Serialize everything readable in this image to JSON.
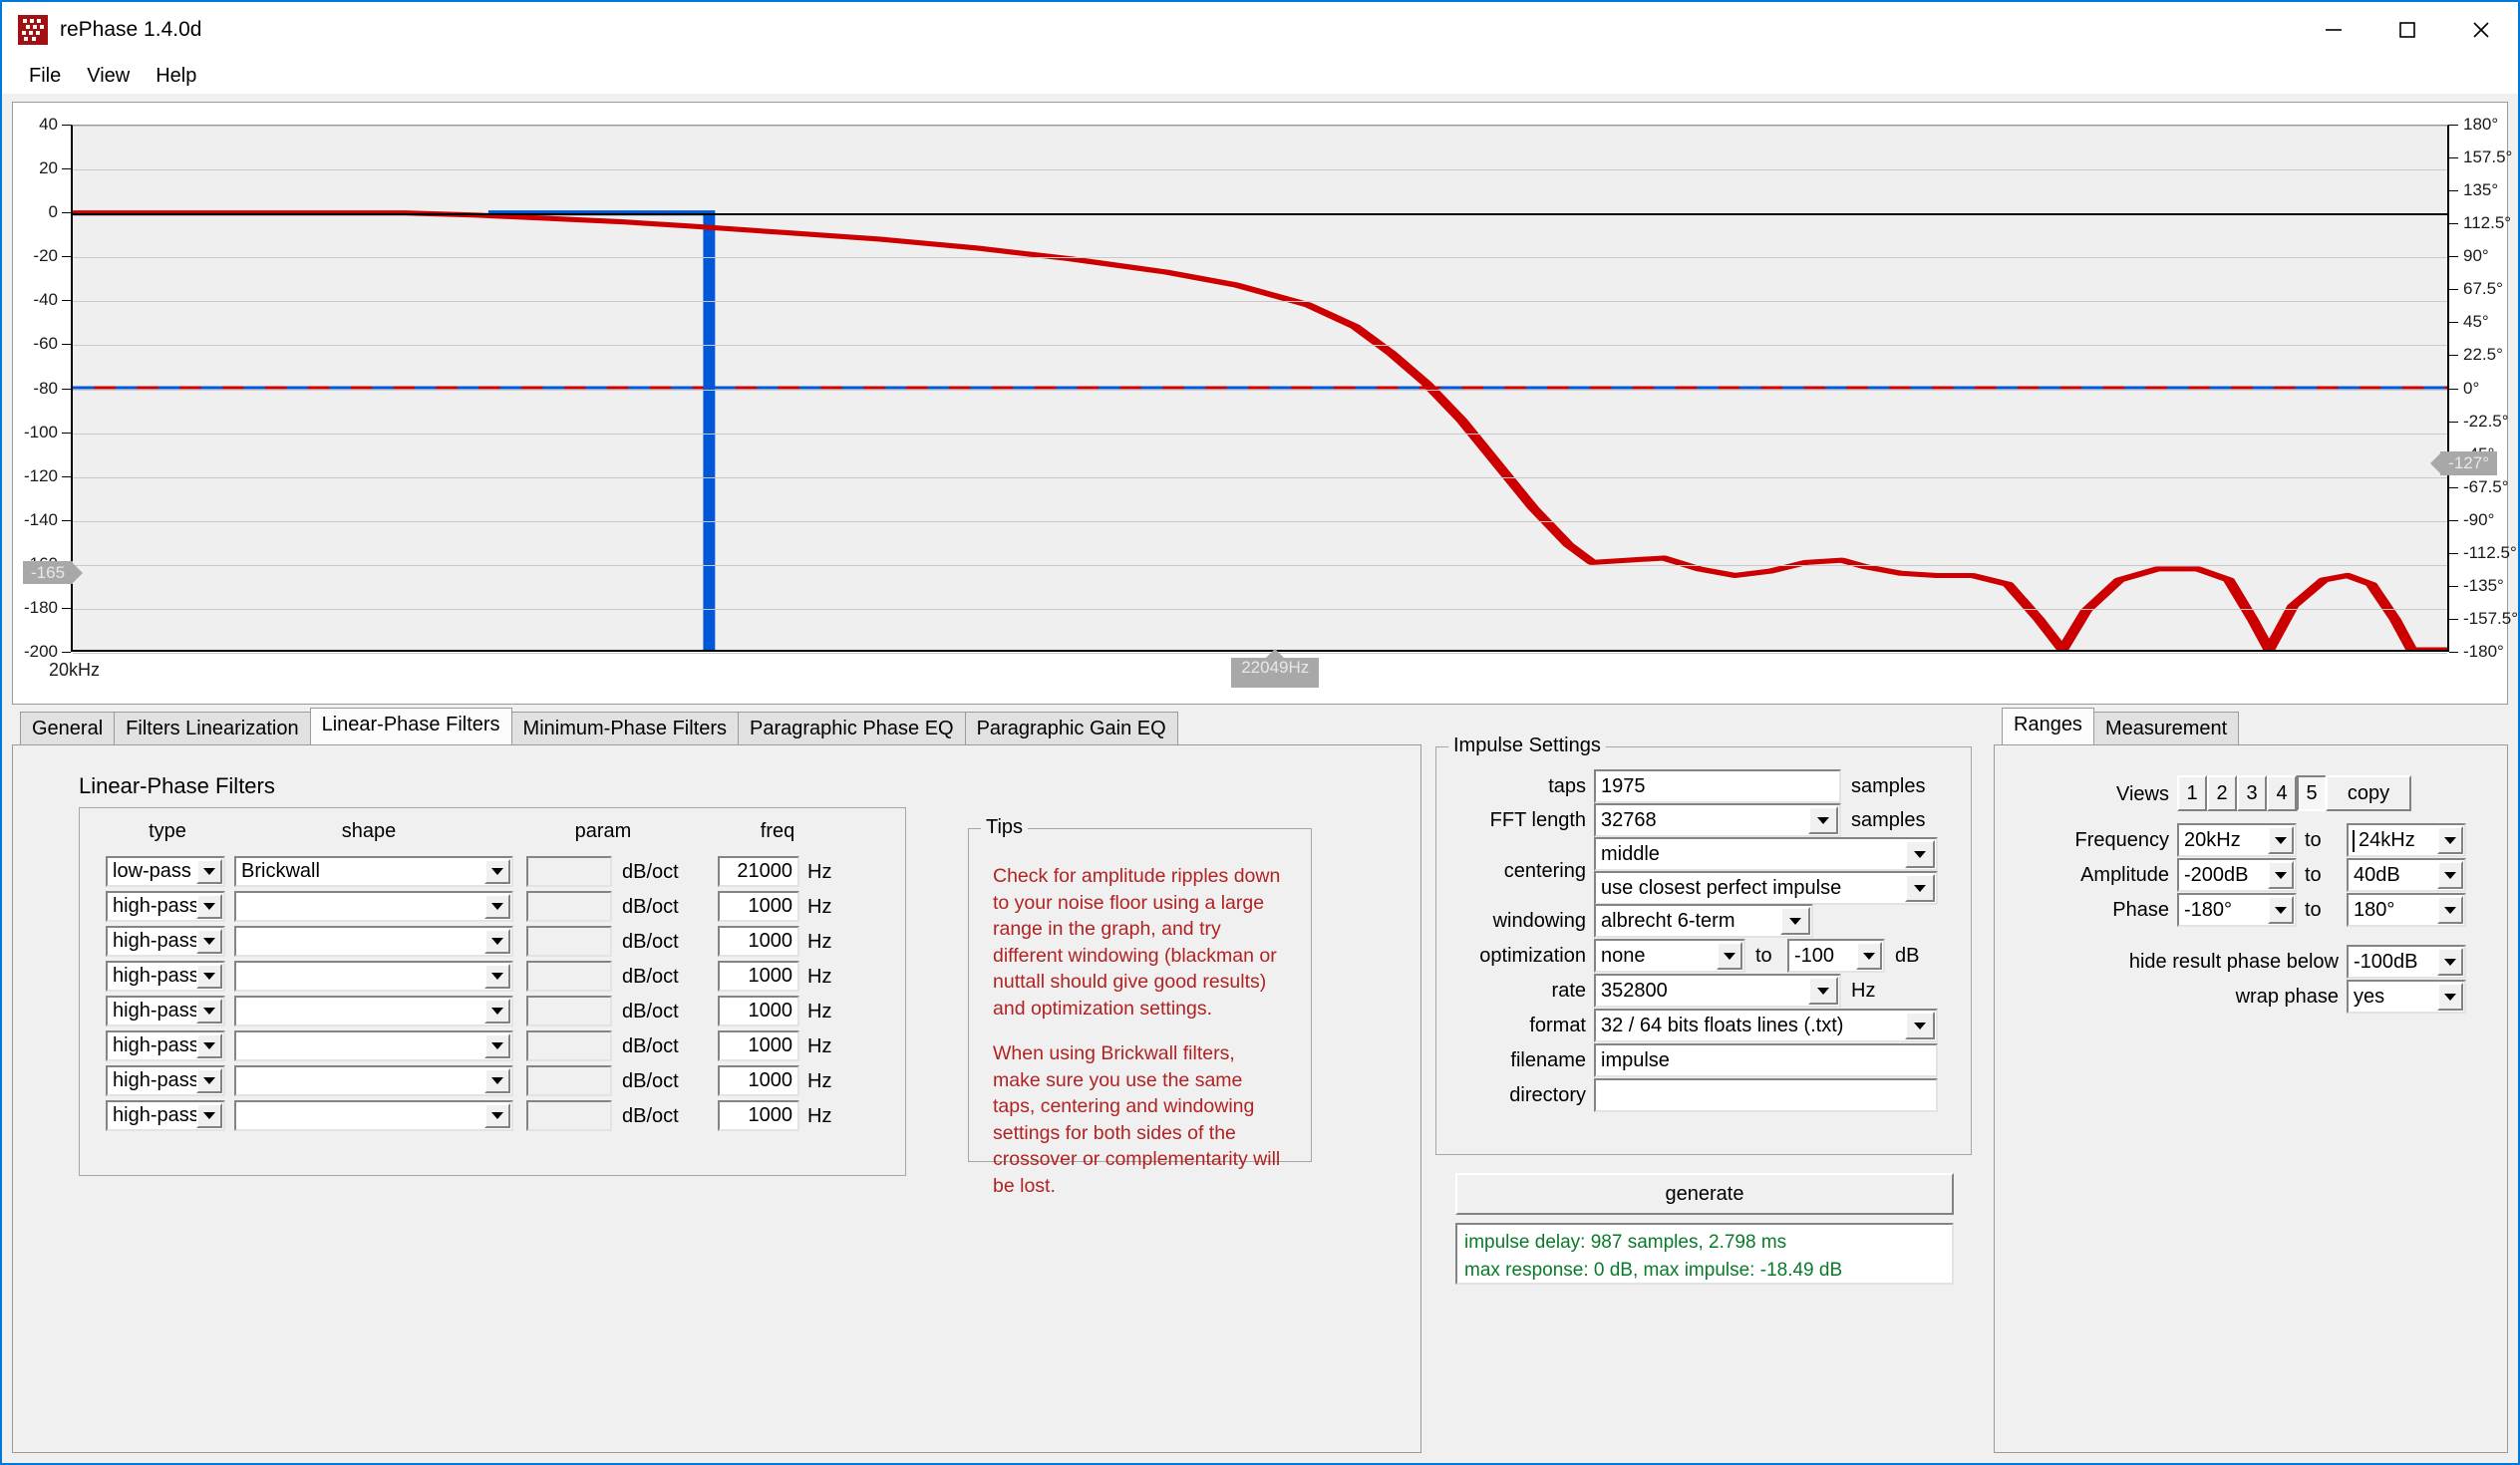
{
  "window": {
    "title": "rePhase 1.4.0d",
    "icon": "rephase-logo-icon",
    "minimize": "─",
    "maximize": "□",
    "close": "✕"
  },
  "menu": {
    "items": [
      "File",
      "View",
      "Help"
    ]
  },
  "chart_data": {
    "type": "line",
    "title": "",
    "xlabel": "",
    "ylabel": "",
    "x_axis_label_left": "20kHz",
    "xlim_labels": [
      "20kHz",
      "24kHz"
    ],
    "y_left_ticks": [
      40,
      20,
      0,
      -20,
      -40,
      -60,
      -80,
      -100,
      -120,
      -140,
      -160,
      -180,
      -200
    ],
    "y_left_unit": "dB",
    "ylim": [
      -200,
      40
    ],
    "y_right_ticks": [
      "180°",
      "157.5°",
      "135°",
      "112.5°",
      "90°",
      "67.5°",
      "45°",
      "22.5°",
      "0°",
      "-22.5°",
      "-45°",
      "-67.5°",
      "-90°",
      "-112.5°",
      "-135°",
      "-157.5°",
      "-180°"
    ],
    "y_right_unit": "degrees",
    "grid": true,
    "legend": "none",
    "cursor_markers": {
      "amplitude": "-165",
      "phase": "-127°",
      "frequency": "22049Hz"
    },
    "series": [
      {
        "name": "amplitude",
        "color": "#cc0000",
        "style": "solid",
        "description": "Brickwall low-pass 21000 Hz magnitude response: flat at 0 dB to ~20.7kHz, gentle roll-off, steep descent past 21kHz to ~-160 dB stopband with scalloped ripple lobes",
        "points": [
          [
            0.0,
            0.0
          ],
          [
            0.14,
            0.0
          ],
          [
            0.17,
            -1.0
          ],
          [
            0.2,
            -2.5
          ],
          [
            0.23,
            -4.0
          ],
          [
            0.26,
            -6.0
          ],
          [
            0.3,
            -9.0
          ],
          [
            0.34,
            -12.0
          ],
          [
            0.38,
            -16.0
          ],
          [
            0.42,
            -21.0
          ],
          [
            0.46,
            -27.0
          ],
          [
            0.49,
            -33.0
          ],
          [
            0.52,
            -42.0
          ],
          [
            0.54,
            -52.0
          ],
          [
            0.555,
            -64.0
          ],
          [
            0.57,
            -78.0
          ],
          [
            0.585,
            -95.0
          ],
          [
            0.6,
            -115.0
          ],
          [
            0.615,
            -135.0
          ],
          [
            0.63,
            -152.0
          ],
          [
            0.64,
            -160.0
          ],
          [
            0.655,
            -159.0
          ],
          [
            0.67,
            -158.0
          ],
          [
            0.685,
            -163.0
          ],
          [
            0.7,
            -166.0
          ],
          [
            0.715,
            -164.0
          ],
          [
            0.73,
            -160.0
          ],
          [
            0.745,
            -159.0
          ],
          [
            0.755,
            -162.0
          ],
          [
            0.77,
            -165.0
          ],
          [
            0.785,
            -166.0
          ],
          [
            0.8,
            -166.0
          ],
          [
            0.815,
            -170.0
          ],
          [
            0.828,
            -186.0
          ],
          [
            0.838,
            -200.0
          ],
          [
            0.848,
            -182.0
          ],
          [
            0.862,
            -168.0
          ],
          [
            0.878,
            -163.0
          ],
          [
            0.895,
            -163.0
          ],
          [
            0.908,
            -168.0
          ],
          [
            0.918,
            -186.0
          ],
          [
            0.925,
            -200.0
          ],
          [
            0.935,
            -180.0
          ],
          [
            0.948,
            -168.0
          ],
          [
            0.958,
            -166.0
          ],
          [
            0.968,
            -170.0
          ],
          [
            0.978,
            -186.0
          ],
          [
            0.985,
            -200.0
          ],
          [
            1.0,
            -200.0
          ]
        ]
      },
      {
        "name": "phase",
        "color": "#0057d8",
        "style": "solid",
        "description": "Linear phase trace: flat at 0 dB reference from ~20.6kHz, then vertical drop at the 21kHz cutoff"
      },
      {
        "name": "hide-phase-threshold",
        "color": "#0057d8",
        "style": "dashed",
        "value_db": -80,
        "description": "dashed blue/red horizontal line at -80 dB"
      },
      {
        "name": "zero-reference",
        "color": "#000000",
        "style": "solid",
        "value_db": 0
      }
    ]
  },
  "main_tabs": {
    "items": [
      "General",
      "Filters Linearization",
      "Linear-Phase Filters",
      "Minimum-Phase Filters",
      "Paragraphic Phase EQ",
      "Paragraphic Gain EQ"
    ],
    "active_index": 2
  },
  "linear_phase_filters": {
    "section_title": "Linear-Phase Filters",
    "columns": [
      "type",
      "shape",
      "param",
      "freq"
    ],
    "param_unit": "dB/oct",
    "freq_unit": "Hz",
    "rows": [
      {
        "type": "low-pass",
        "shape": "Brickwall",
        "param": "",
        "freq": "21000"
      },
      {
        "type": "high-pass",
        "shape": "",
        "param": "",
        "freq": "1000"
      },
      {
        "type": "high-pass",
        "shape": "",
        "param": "",
        "freq": "1000"
      },
      {
        "type": "high-pass",
        "shape": "",
        "param": "",
        "freq": "1000"
      },
      {
        "type": "high-pass",
        "shape": "",
        "param": "",
        "freq": "1000"
      },
      {
        "type": "high-pass",
        "shape": "",
        "param": "",
        "freq": "1000"
      },
      {
        "type": "high-pass",
        "shape": "",
        "param": "",
        "freq": "1000"
      },
      {
        "type": "high-pass",
        "shape": "",
        "param": "",
        "freq": "1000"
      }
    ]
  },
  "tips": {
    "title": "Tips",
    "paragraph1": "Check for amplitude ripples down to your noise floor using a large range in the graph, and try different windowing (blackman or nuttall should give good results) and optimization settings.",
    "paragraph2": "When using Brickwall filters, make sure you use the same taps, centering and windowing settings for both sides of the crossover or complementarity will be lost."
  },
  "impulse_settings": {
    "title": "Impulse Settings",
    "taps": {
      "label": "taps",
      "value": "1975",
      "unit": "samples"
    },
    "fft_length": {
      "label": "FFT length",
      "value": "32768",
      "unit": "samples"
    },
    "centering": {
      "label": "centering",
      "value1": "middle",
      "value2": "use closest perfect impulse"
    },
    "windowing": {
      "label": "windowing",
      "value": "albrecht 6-term"
    },
    "optimization": {
      "label": "optimization",
      "value": "none",
      "to_label": "to",
      "to_value": "-100",
      "unit": "dB"
    },
    "rate": {
      "label": "rate",
      "value": "352800",
      "unit": "Hz"
    },
    "format": {
      "label": "format",
      "value": "32 / 64 bits floats lines (.txt)"
    },
    "filename": {
      "label": "filename",
      "value": "impulse"
    },
    "directory": {
      "label": "directory",
      "value": ""
    },
    "generate_button": "generate",
    "status_line1": "impulse delay: 987 samples, 2.798 ms",
    "status_line2": "max response: 0 dB, max impulse: -18.49 dB",
    "status_color": "#0a7a2a"
  },
  "right_tabs": {
    "items": [
      "Ranges",
      "Measurement"
    ],
    "active_index": 0
  },
  "ranges": {
    "views": {
      "label": "Views",
      "buttons": [
        "1",
        "2",
        "3",
        "4",
        "5"
      ],
      "active": "5",
      "copy_label": "copy"
    },
    "frequency": {
      "label": "Frequency",
      "from": "20kHz",
      "to_label": "to",
      "to": "24kHz"
    },
    "amplitude": {
      "label": "Amplitude",
      "from": "-200dB",
      "to_label": "to",
      "to": "40dB"
    },
    "phase": {
      "label": "Phase",
      "from": "-180°",
      "to_label": "to",
      "to": "180°"
    },
    "hide_phase": {
      "label": "hide result phase below",
      "value": "-100dB"
    },
    "wrap_phase": {
      "label": "wrap phase",
      "value": "yes"
    }
  }
}
